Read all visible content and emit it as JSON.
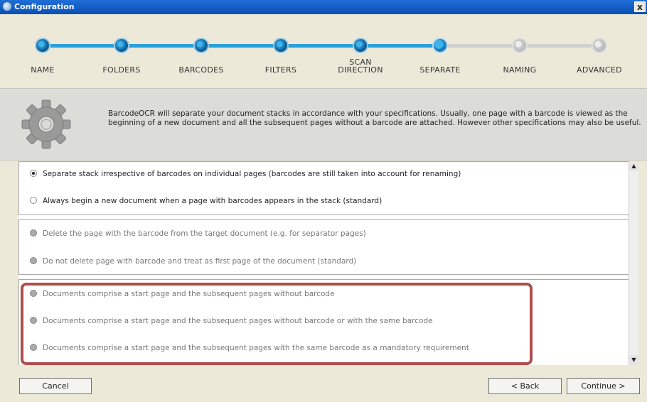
{
  "window": {
    "title": "Configuration",
    "close_label": "x"
  },
  "steps": [
    {
      "label": "NAME",
      "state": "done"
    },
    {
      "label": "FOLDERS",
      "state": "done"
    },
    {
      "label": "BARCODES",
      "state": "done"
    },
    {
      "label": "FILTERS",
      "state": "done"
    },
    {
      "label": "SCAN\nDIRECTION",
      "state": "done"
    },
    {
      "label": "SEPARATE",
      "state": "current"
    },
    {
      "label": "NAMING",
      "state": "todo"
    },
    {
      "label": "ADVANCED",
      "state": "todo"
    }
  ],
  "info": {
    "icon": "gear-icon",
    "text": "BarcodeOCR will separate your document stacks in accordance with your specifications. Usually, one page with a barcode is viewed as the beginning of a new document and all the subsequent pages without a barcode are attached. However other specifications may also be useful."
  },
  "groups": [
    {
      "options": [
        {
          "label": "Separate stack irrespective of barcodes on individual pages (barcodes are still taken into account for renaming)",
          "selected": true,
          "enabled": true
        },
        {
          "label": "Always begin a new document when a page with barcodes appears in the stack (standard)",
          "selected": false,
          "enabled": true
        }
      ]
    },
    {
      "options": [
        {
          "label": "Delete the page with the barcode from the target document (e.g. for separator pages)",
          "selected": false,
          "enabled": false
        },
        {
          "label": "Do not delete page with barcode and treat as first page of the document (standard)",
          "selected": false,
          "enabled": false
        }
      ]
    },
    {
      "options": [
        {
          "label": "Documents comprise a start page and the subsequent pages without barcode",
          "selected": false,
          "enabled": false
        },
        {
          "label": "Documents comprise a start page and the subsequent pages without barcode or with the same barcode",
          "selected": false,
          "enabled": false
        },
        {
          "label": "Documents comprise a start page and the subsequent pages with the same barcode as a mandatory requirement",
          "selected": false,
          "enabled": false
        }
      ]
    }
  ],
  "buttons": {
    "cancel": "Cancel",
    "back": "< Back",
    "continue": "Continue >"
  },
  "colors": {
    "accent": "#1e7fbf",
    "highlight": "#b04e4e"
  }
}
